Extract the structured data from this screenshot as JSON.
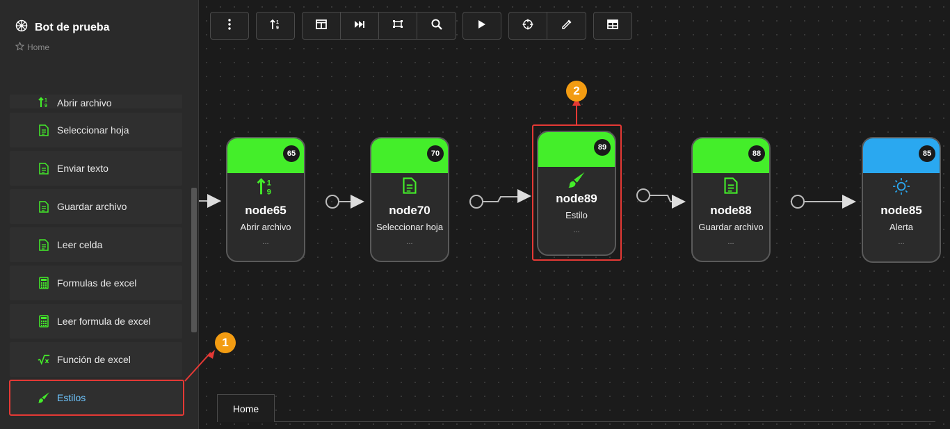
{
  "app": {
    "title": "Bot de prueba",
    "breadcrumb": "Home"
  },
  "sidebar": {
    "items": [
      {
        "label": "Abrir archivo",
        "icon": "sort-icon"
      },
      {
        "label": "Seleccionar hoja",
        "icon": "file-icon"
      },
      {
        "label": "Enviar texto",
        "icon": "file-icon"
      },
      {
        "label": "Guardar archivo",
        "icon": "file-icon"
      },
      {
        "label": "Leer celda",
        "icon": "file-icon"
      },
      {
        "label": "Formulas de excel",
        "icon": "calculator-icon"
      },
      {
        "label": "Leer formula de excel",
        "icon": "calculator-icon"
      },
      {
        "label": "Función de excel",
        "icon": "square-root-icon"
      },
      {
        "label": "Estilos",
        "icon": "brush-icon"
      }
    ]
  },
  "toolbar": {
    "buttons": [
      "more-icon",
      "sort-icon",
      "layout-icon",
      "fast-forward-icon",
      "transform-icon",
      "search-icon",
      "play-icon",
      "crosshair-icon",
      "eyedropper-icon",
      "table-icon"
    ]
  },
  "nodes": [
    {
      "id": "65",
      "name": "node65",
      "label": "Abrir archivo",
      "dots": "...",
      "icon": "sort-icon"
    },
    {
      "id": "70",
      "name": "node70",
      "label": "Seleccionar hoja",
      "dots": "...",
      "icon": "file-icon"
    },
    {
      "id": "89",
      "name": "node89",
      "label": "Estilo",
      "dots": "...",
      "icon": "brush-icon"
    },
    {
      "id": "88",
      "name": "node88",
      "label": "Guardar archivo",
      "dots": "...",
      "icon": "file-icon"
    },
    {
      "id": "85",
      "name": "node85",
      "label": "Alerta",
      "dots": "...",
      "icon": "sun-icon"
    }
  ],
  "annotations": {
    "marker1": "1",
    "marker2": "2"
  },
  "tabs": {
    "home": "Home"
  },
  "colors": {
    "accent_green": "#44ee2a",
    "accent_blue": "#2aa8f0",
    "highlight": "#e53935",
    "marker": "#f39c12",
    "active_text": "#6ec6ff"
  }
}
